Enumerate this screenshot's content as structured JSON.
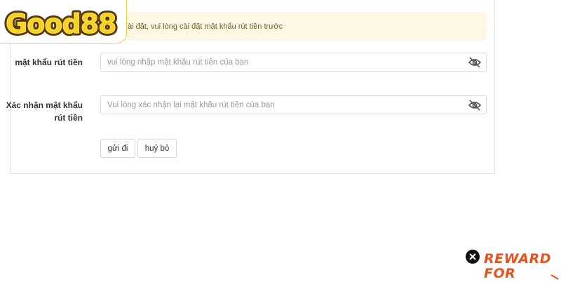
{
  "brand": {
    "logo_text": "Good88"
  },
  "alert": {
    "text": "ài đặt, vui lòng cài đặt mật khẩu rút tiền trước"
  },
  "form": {
    "password": {
      "label": "mật khẩu rút tiền",
      "placeholder": "vui lòng nhập mật khẩu rút tiền của bạn",
      "value": ""
    },
    "confirm": {
      "label": "Xác nhận mật khẩu rút tiền",
      "placeholder": "Vui lòng xác nhận lại mật khẩu rút tiền của bạn",
      "value": ""
    },
    "submit_label": "gửi đi",
    "cancel_label": "huỷ bỏ"
  },
  "reward_banner": {
    "line1": "REWARD",
    "line2": "FOR"
  },
  "colors": {
    "alert_bg": "#fcf8e3",
    "logo_fill": "#f7d21e",
    "logo_outline": "#5b3a06",
    "reward_text": "#e8521f"
  },
  "icons": {
    "visibility": "eye-slash-icon",
    "close": "close-icon",
    "arrow": "arrow-icon"
  }
}
